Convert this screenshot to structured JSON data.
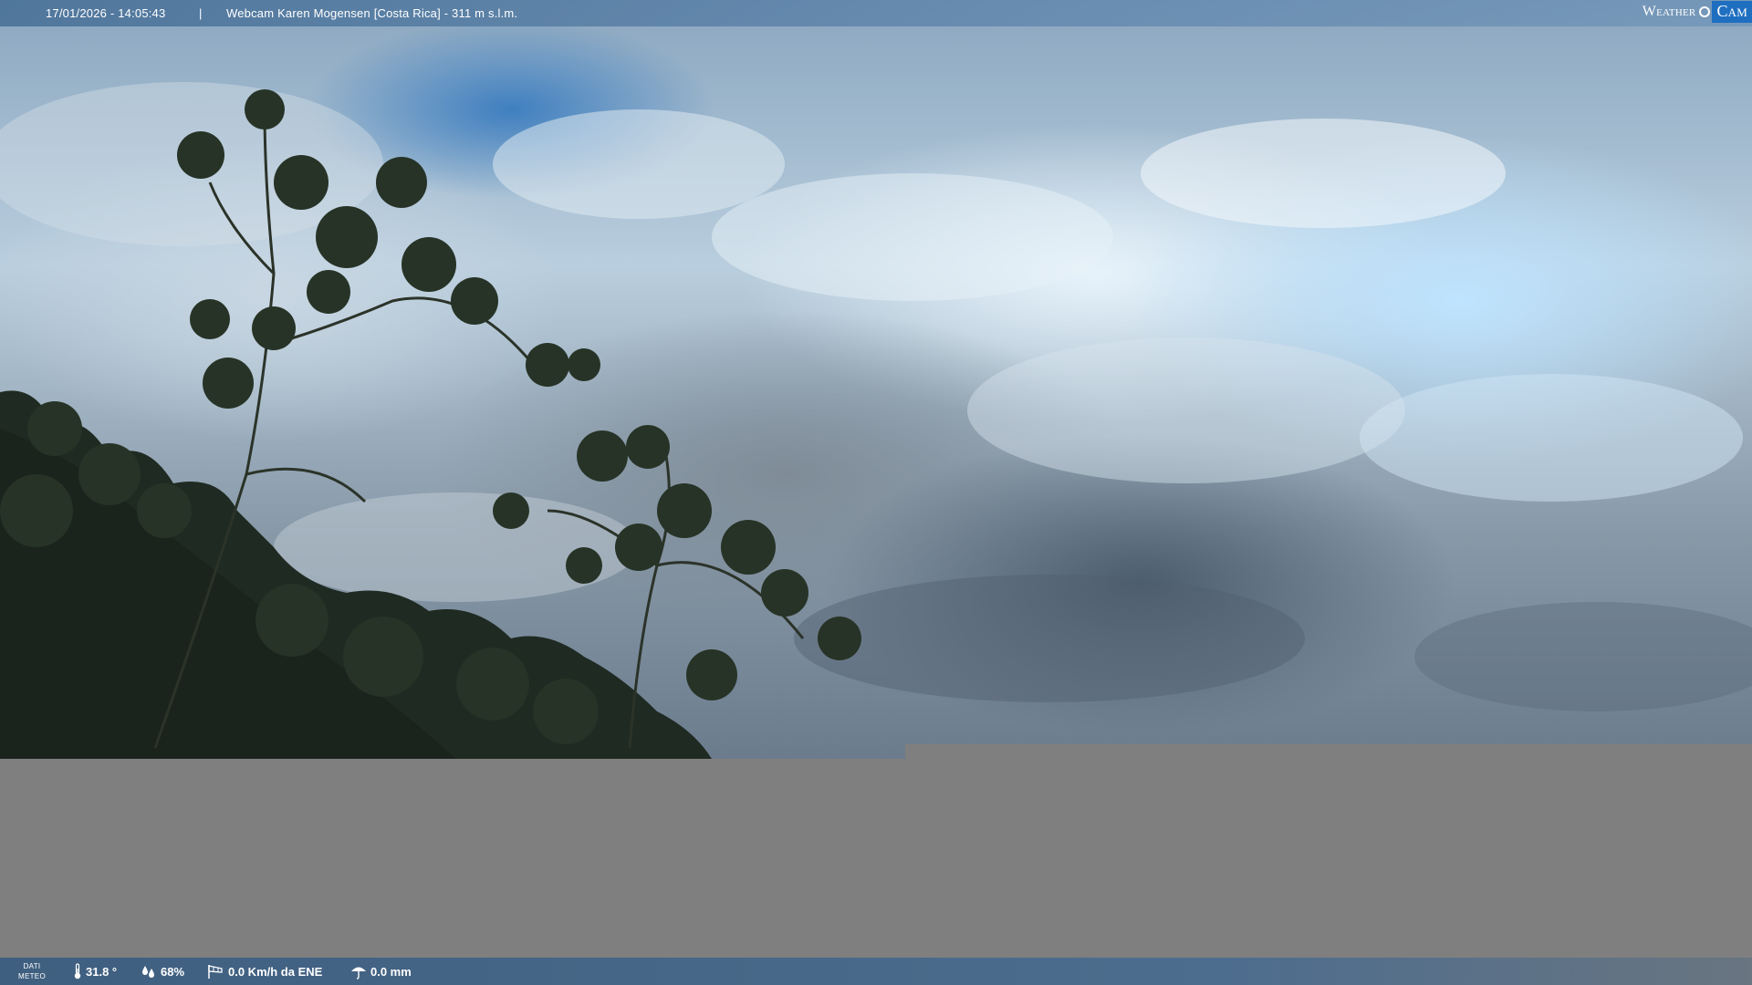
{
  "overlay": {
    "datetime": "17/01/2026 - 14:05:43",
    "separator": "|",
    "title": "Webcam Karen Mogensen [Costa Rica] - 311 m s.l.m."
  },
  "logo": {
    "part1": "Weather",
    "part2": "Cam"
  },
  "weather_bar": {
    "label_line1": "DATI",
    "label_line2": "METEO",
    "temperature": "31.8 °",
    "humidity": "68%",
    "wind": "0.0 Km/h da ENE",
    "rain": "0.0 mm"
  },
  "icons": {
    "temperature": "thermometer-icon",
    "humidity": "humidity-drops-icon",
    "wind": "wind-sock-icon",
    "rain": "umbrella-icon"
  }
}
